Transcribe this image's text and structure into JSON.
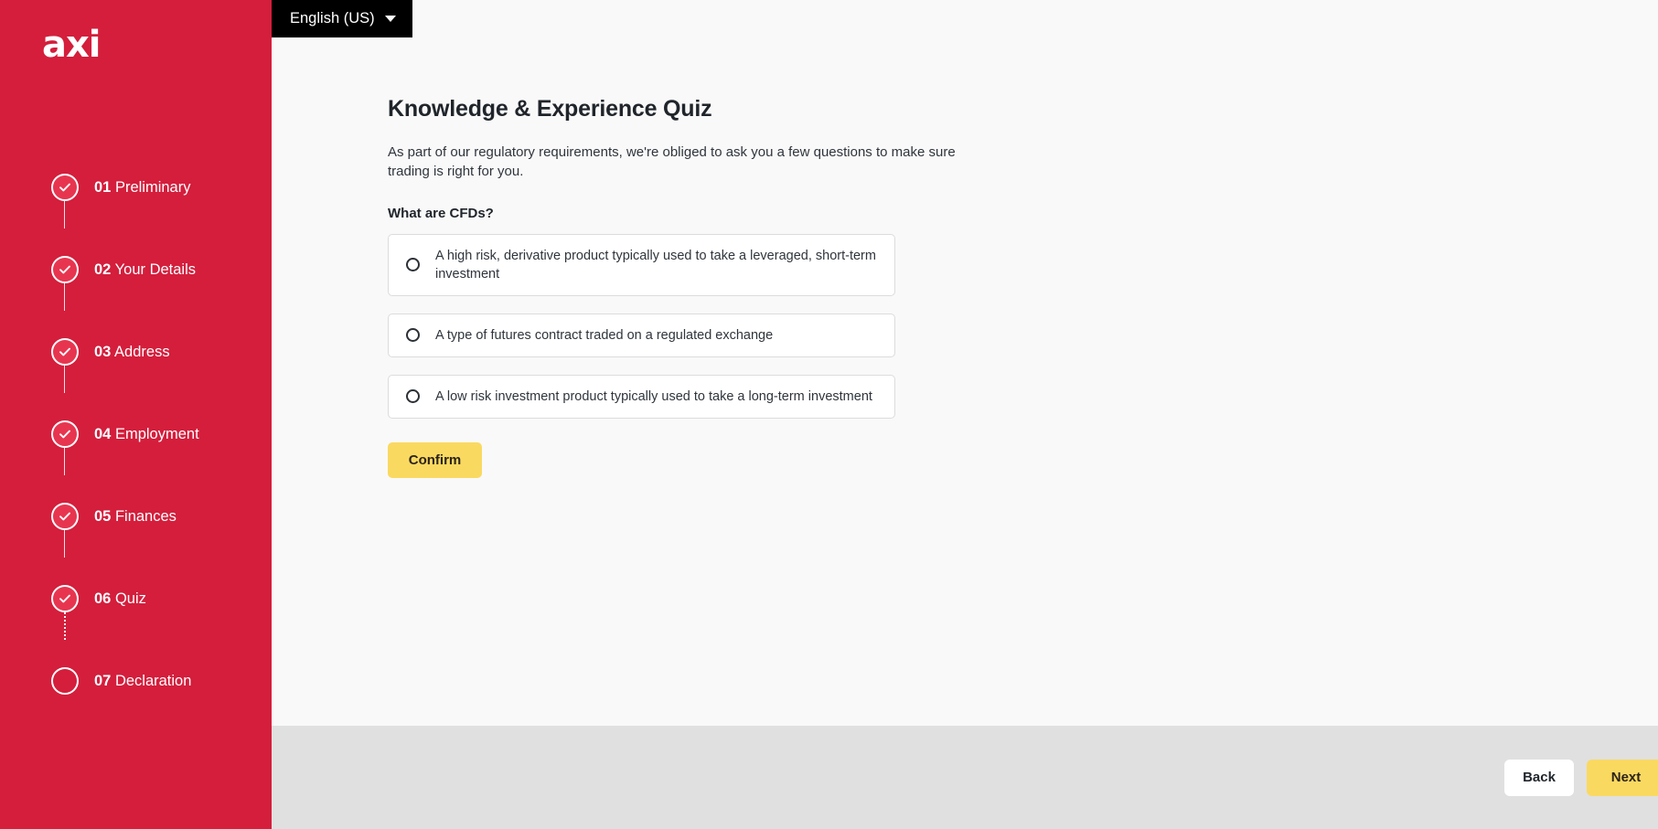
{
  "brand": {
    "logo_text": "axi",
    "sidebar_color": "#d41e3c",
    "accent_yellow": "#fad961",
    "step_fill": "#e8354f"
  },
  "language_selector": {
    "label": "English (US)",
    "icon": "chevron-down-icon"
  },
  "sidebar": {
    "steps": [
      {
        "number": "01",
        "label": "Preliminary",
        "state": "complete"
      },
      {
        "number": "02",
        "label": "Your Details",
        "state": "complete"
      },
      {
        "number": "03",
        "label": "Address",
        "state": "complete"
      },
      {
        "number": "04",
        "label": "Employment",
        "state": "complete"
      },
      {
        "number": "05",
        "label": "Finances",
        "state": "complete"
      },
      {
        "number": "06",
        "label": "Quiz",
        "state": "complete"
      },
      {
        "number": "07",
        "label": "Declaration",
        "state": "pending"
      }
    ]
  },
  "main": {
    "title": "Knowledge & Experience Quiz",
    "description": "As part of our regulatory requirements, we're obliged to ask you a few questions to make sure trading is right for you.",
    "question": "What are CFDs?",
    "options": [
      {
        "text": "A high risk, derivative product typically used to take a leveraged, short-term investment",
        "selected": false
      },
      {
        "text": "A type of futures contract traded on a regulated exchange",
        "selected": false
      },
      {
        "text": "A low risk investment product typically used to take a long-term investment",
        "selected": false
      }
    ],
    "confirm_label": "Confirm"
  },
  "footer": {
    "back_label": "Back",
    "next_label": "Next"
  }
}
